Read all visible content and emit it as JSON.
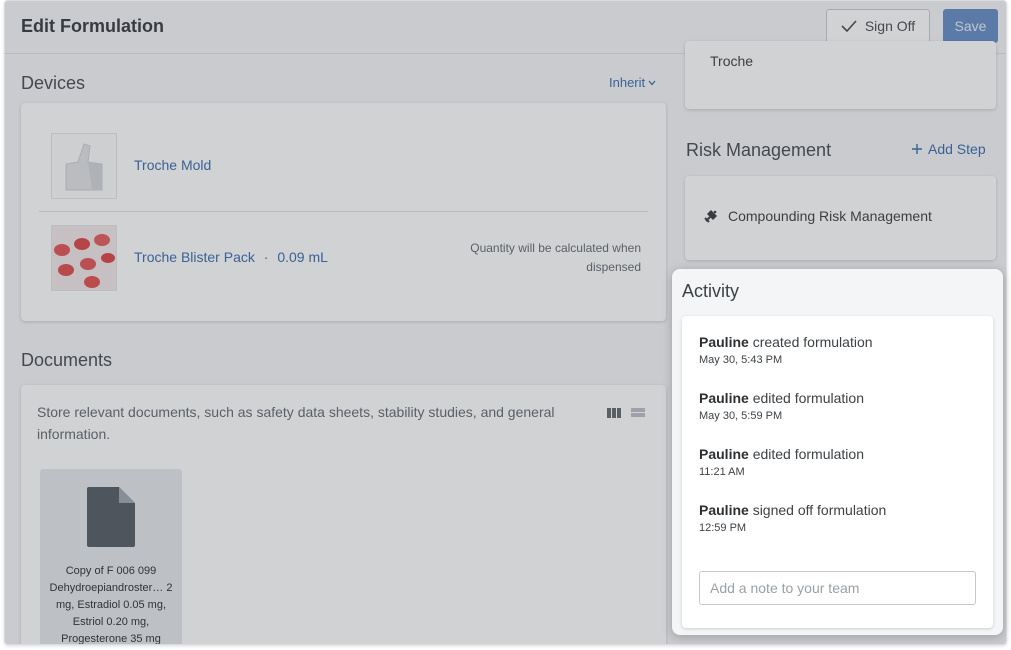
{
  "header": {
    "title": "Edit Formulation",
    "signoff_label": "Sign Off",
    "save_label": "Save"
  },
  "devices": {
    "title": "Devices",
    "inherit_label": "Inherit",
    "items": [
      {
        "name": "Troche Mold"
      },
      {
        "name": "Troche Blister Pack",
        "separator": "·",
        "amount": "0.09 mL",
        "note": "Quantity will be calculated when dispensed"
      }
    ]
  },
  "documents": {
    "title": "Documents",
    "description": "Store relevant documents, such as safety data sheets, stability studies, and general information.",
    "files": [
      {
        "name": "Copy of F 006 099 Dehydroepiandroster… 2 mg, Estradiol 0.05 mg, Estriol 0.20 mg, Progesterone 35 mg"
      }
    ]
  },
  "top_card": {
    "text": "Troche"
  },
  "risk": {
    "title": "Risk Management",
    "add_step_label": "Add Step",
    "items": [
      {
        "label": "Compounding Risk Management"
      }
    ]
  },
  "activity": {
    "title": "Activity",
    "items": [
      {
        "user": "Pauline",
        "action": "created formulation",
        "time": "May 30, 5:43 PM"
      },
      {
        "user": "Pauline",
        "action": "edited formulation",
        "time": "May 30, 5:59 PM"
      },
      {
        "user": "Pauline",
        "action": "edited formulation",
        "time": "11:21 AM"
      },
      {
        "user": "Pauline",
        "action": "signed off formulation",
        "time": "12:59 PM"
      }
    ],
    "note_placeholder": "Add a note to your team"
  },
  "colors": {
    "link": "#2f64a8",
    "save_button": "#5c86c2",
    "highlight_panel": "#f4f5f7"
  }
}
